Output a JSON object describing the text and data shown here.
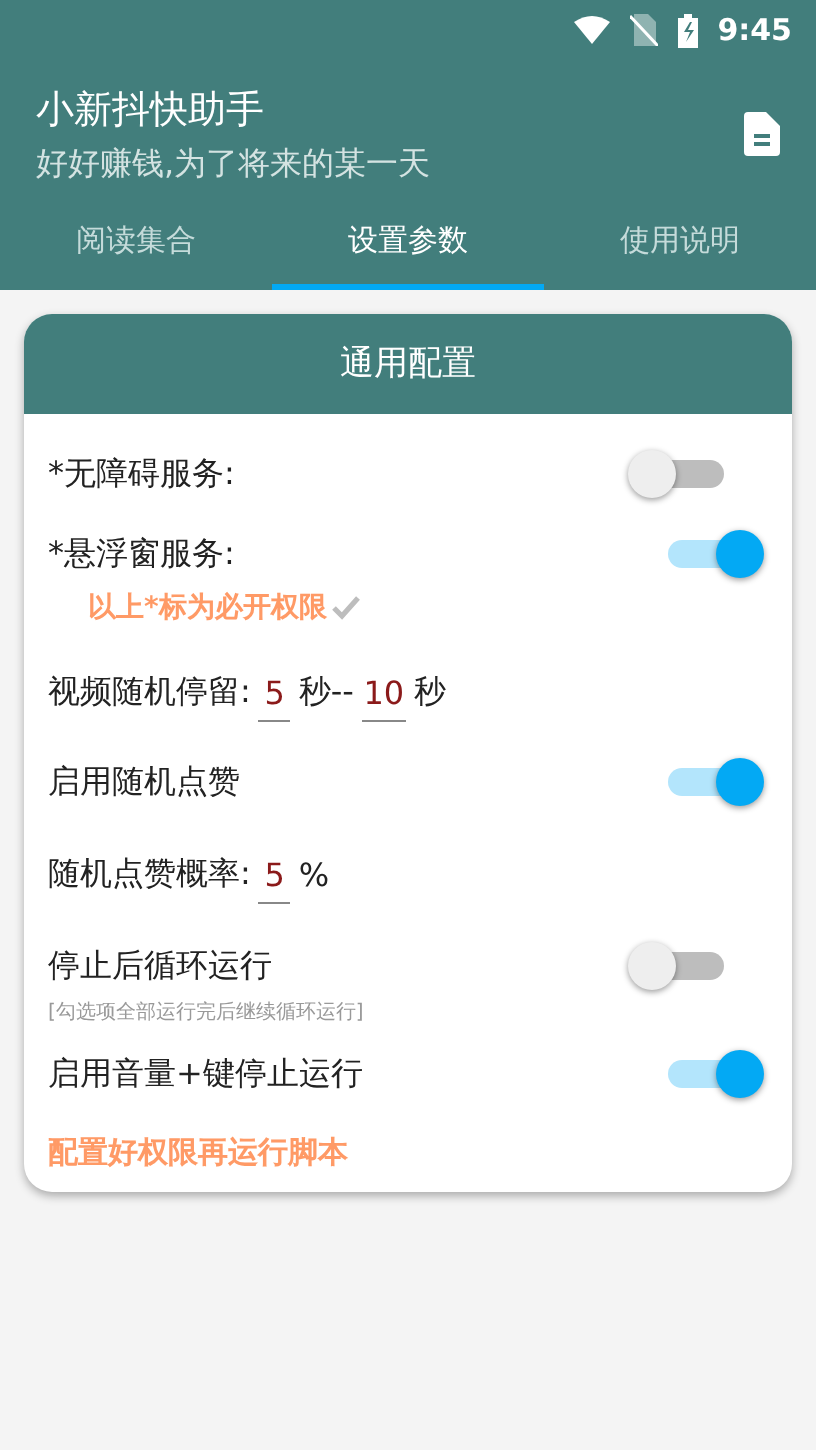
{
  "status_bar": {
    "time": "9:45"
  },
  "app_bar": {
    "title": "小新抖快助手",
    "subtitle": "好好赚钱,为了将来的某一天"
  },
  "tabs": [
    {
      "label": "阅读集合",
      "selected": false
    },
    {
      "label": "设置参数",
      "selected": true
    },
    {
      "label": "使用说明",
      "selected": false
    }
  ],
  "card": {
    "title": "通用配置",
    "rows": [
      {
        "kind": "switch",
        "label": "*无障碍服务:",
        "on": false
      },
      {
        "kind": "switch",
        "label": "*悬浮窗服务:",
        "on": true,
        "note": "以上*标为必开权限"
      },
      {
        "kind": "range",
        "label": "视频随机停留:",
        "from": "5",
        "middle": "秒--",
        "to": "10",
        "unit": "秒"
      },
      {
        "kind": "switch",
        "label": "启用随机点赞",
        "on": true
      },
      {
        "kind": "input",
        "label": "随机点赞概率:",
        "value": "5",
        "unit": "%"
      },
      {
        "kind": "switch",
        "label": "停止后循环运行",
        "on": false,
        "hint": "[勾选项全部运行完后继续循环运行]"
      },
      {
        "kind": "switch",
        "label": "启用音量+键停止运行",
        "on": true
      }
    ],
    "footer": "配置好权限再运行脚本"
  }
}
